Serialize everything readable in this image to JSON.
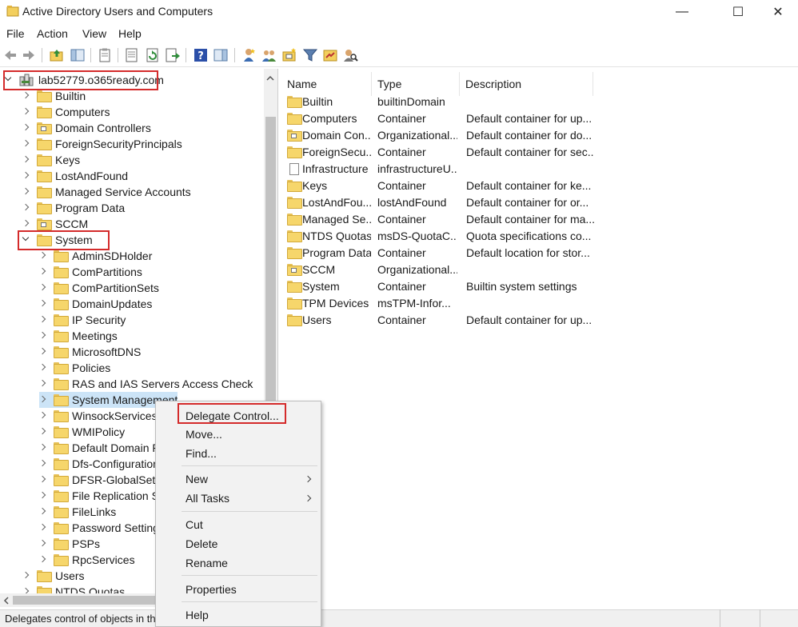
{
  "window": {
    "title": "Active Directory Users and Computers",
    "minimize": "—",
    "maximize": "☐",
    "close": "✕"
  },
  "menu": [
    "File",
    "Action",
    "View",
    "Help"
  ],
  "toolbar": {
    "icons": [
      "back-arrow-icon",
      "forward-arrow-icon",
      "up-folder-icon",
      "show-console-tree-icon",
      "clipboard-icon",
      "properties-icon",
      "refresh-icon",
      "export-list-icon",
      "help-icon",
      "action-pane-icon",
      "new-user-icon",
      "new-group-icon",
      "new-ou-icon",
      "filter-icon",
      "add-to-group-icon",
      "find-icon"
    ]
  },
  "tree": {
    "root": "lab52779.o365ready.com",
    "top_items": [
      {
        "label": "Builtin",
        "ou": false
      },
      {
        "label": "Computers",
        "ou": false
      },
      {
        "label": "Domain Controllers",
        "ou": true
      },
      {
        "label": "ForeignSecurityPrincipals",
        "ou": false
      },
      {
        "label": "Keys",
        "ou": false
      },
      {
        "label": "LostAndFound",
        "ou": false
      },
      {
        "label": "Managed Service Accounts",
        "ou": false
      },
      {
        "label": "Program Data",
        "ou": false
      },
      {
        "label": "SCCM",
        "ou": true
      }
    ],
    "system": "System",
    "system_children": [
      {
        "label": "AdminSDHolder"
      },
      {
        "label": "ComPartitions"
      },
      {
        "label": "ComPartitionSets"
      },
      {
        "label": "DomainUpdates"
      },
      {
        "label": "IP Security"
      },
      {
        "label": "Meetings"
      },
      {
        "label": "MicrosoftDNS"
      },
      {
        "label": "Policies"
      },
      {
        "label": "RAS and IAS Servers Access Check"
      },
      {
        "label": "System Management"
      },
      {
        "label": "WinsockServices"
      },
      {
        "label": "WMIPolicy"
      },
      {
        "label": "Default Domain P"
      },
      {
        "label": "Dfs-Configuration"
      },
      {
        "label": "DFSR-GlobalSettin"
      },
      {
        "label": "File Replication Se"
      },
      {
        "label": "FileLinks"
      },
      {
        "label": "Password Settings"
      },
      {
        "label": "PSPs"
      },
      {
        "label": "RpcServices"
      }
    ],
    "after_items": [
      "Users",
      "NTDS Quotas"
    ]
  },
  "list": {
    "headers": {
      "name": "Name",
      "type": "Type",
      "description": "Description"
    },
    "rows": [
      {
        "name": "Builtin",
        "type": "builtinDomain",
        "description": "",
        "icon": "folder"
      },
      {
        "name": "Computers",
        "type": "Container",
        "description": "Default container for up...",
        "icon": "folder"
      },
      {
        "name": "Domain Con...",
        "type": "Organizational...",
        "description": "Default container for do...",
        "icon": "ou"
      },
      {
        "name": "ForeignSecu...",
        "type": "Container",
        "description": "Default container for sec...",
        "icon": "folder"
      },
      {
        "name": "Infrastructure",
        "type": "infrastructureU...",
        "description": "",
        "icon": "file"
      },
      {
        "name": "Keys",
        "type": "Container",
        "description": "Default container for ke...",
        "icon": "folder"
      },
      {
        "name": "LostAndFou...",
        "type": "lostAndFound",
        "description": "Default container for or...",
        "icon": "folder"
      },
      {
        "name": "Managed Se...",
        "type": "Container",
        "description": "Default container for ma...",
        "icon": "folder"
      },
      {
        "name": "NTDS Quotas",
        "type": "msDS-QuotaC...",
        "description": "Quota specifications co...",
        "icon": "folder"
      },
      {
        "name": "Program Data",
        "type": "Container",
        "description": "Default location for stor...",
        "icon": "folder"
      },
      {
        "name": "SCCM",
        "type": "Organizational...",
        "description": "",
        "icon": "ou"
      },
      {
        "name": "System",
        "type": "Container",
        "description": "Builtin system settings",
        "icon": "folder"
      },
      {
        "name": "TPM Devices",
        "type": "msTPM-Infor...",
        "description": "",
        "icon": "folder"
      },
      {
        "name": "Users",
        "type": "Container",
        "description": "Default container for up...",
        "icon": "folder"
      }
    ]
  },
  "context_menu": {
    "delegate": "Delegate Control...",
    "move": "Move...",
    "find": "Find...",
    "new": "New",
    "all_tasks": "All Tasks",
    "cut": "Cut",
    "delete": "Delete",
    "rename": "Rename",
    "properties": "Properties",
    "help": "Help"
  },
  "status": "Delegates control of objects in th",
  "colors": {
    "highlight": "#d42b2b",
    "selection": "#cce4f7",
    "folder": "#f6d66b"
  }
}
